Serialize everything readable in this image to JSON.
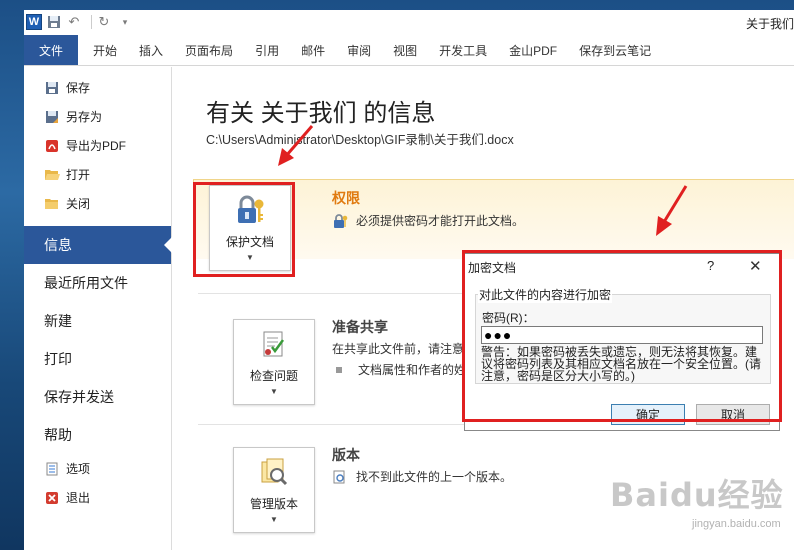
{
  "titlebar": {
    "app_icon": "word-icon",
    "app_icon_letter": "W",
    "doc_title": "关于我们"
  },
  "ribbon": {
    "tabs": [
      "文件",
      "开始",
      "插入",
      "页面布局",
      "引用",
      "邮件",
      "审阅",
      "视图",
      "开发工具",
      "金山PDF",
      "保存到云笔记"
    ]
  },
  "sidebar": {
    "top_items": [
      {
        "label": "保存",
        "icon": "save-icon"
      },
      {
        "label": "另存为",
        "icon": "save-as-icon"
      },
      {
        "label": "导出为PDF",
        "icon": "pdf-icon"
      },
      {
        "label": "打开",
        "icon": "open-folder-icon"
      },
      {
        "label": "关闭",
        "icon": "close-folder-icon"
      }
    ],
    "big_items": [
      "信息",
      "最近所用文件",
      "新建",
      "打印",
      "保存并发送",
      "帮助"
    ],
    "bottom_items": [
      {
        "label": "选项",
        "icon": "options-icon"
      },
      {
        "label": "退出",
        "icon": "exit-icon"
      }
    ]
  },
  "info": {
    "title": "有关 关于我们 的信息",
    "path": "C:\\Users\\Administrator\\Desktop\\GIF录制\\关于我们.docx",
    "protect": {
      "button_label": "保护文档",
      "heading": "权限",
      "text": "必须提供密码才能打开此文档。"
    },
    "inspect": {
      "button_label": "检查问题",
      "heading": "准备共享",
      "text": "在共享此文件前，请注意其",
      "bullet": "文档属性和作者的姓名"
    },
    "versions": {
      "button_label": "管理版本",
      "heading": "版本",
      "text": "找不到此文件的上一个版本。"
    }
  },
  "dialog": {
    "title": "加密文档",
    "help": "?",
    "close": "✕",
    "group_title": "对此文件的内容进行加密",
    "password_label": "密码(R)：",
    "password_value": "●●●",
    "warning": "警告：如果密码被丢失或遗忘，则无法将其恢复。建议将密码列表及其相应文档名放在一个安全位置。(请注意，密码是区分大小写的。)",
    "ok": "确定",
    "cancel": "取消"
  },
  "watermark": {
    "logo": "Baidu经验",
    "site": "jingyan.baidu.com"
  },
  "colors": {
    "file_tab_blue": "#2b579a",
    "permission_orange": "#e07a10",
    "highlight_red": "#e02020"
  }
}
